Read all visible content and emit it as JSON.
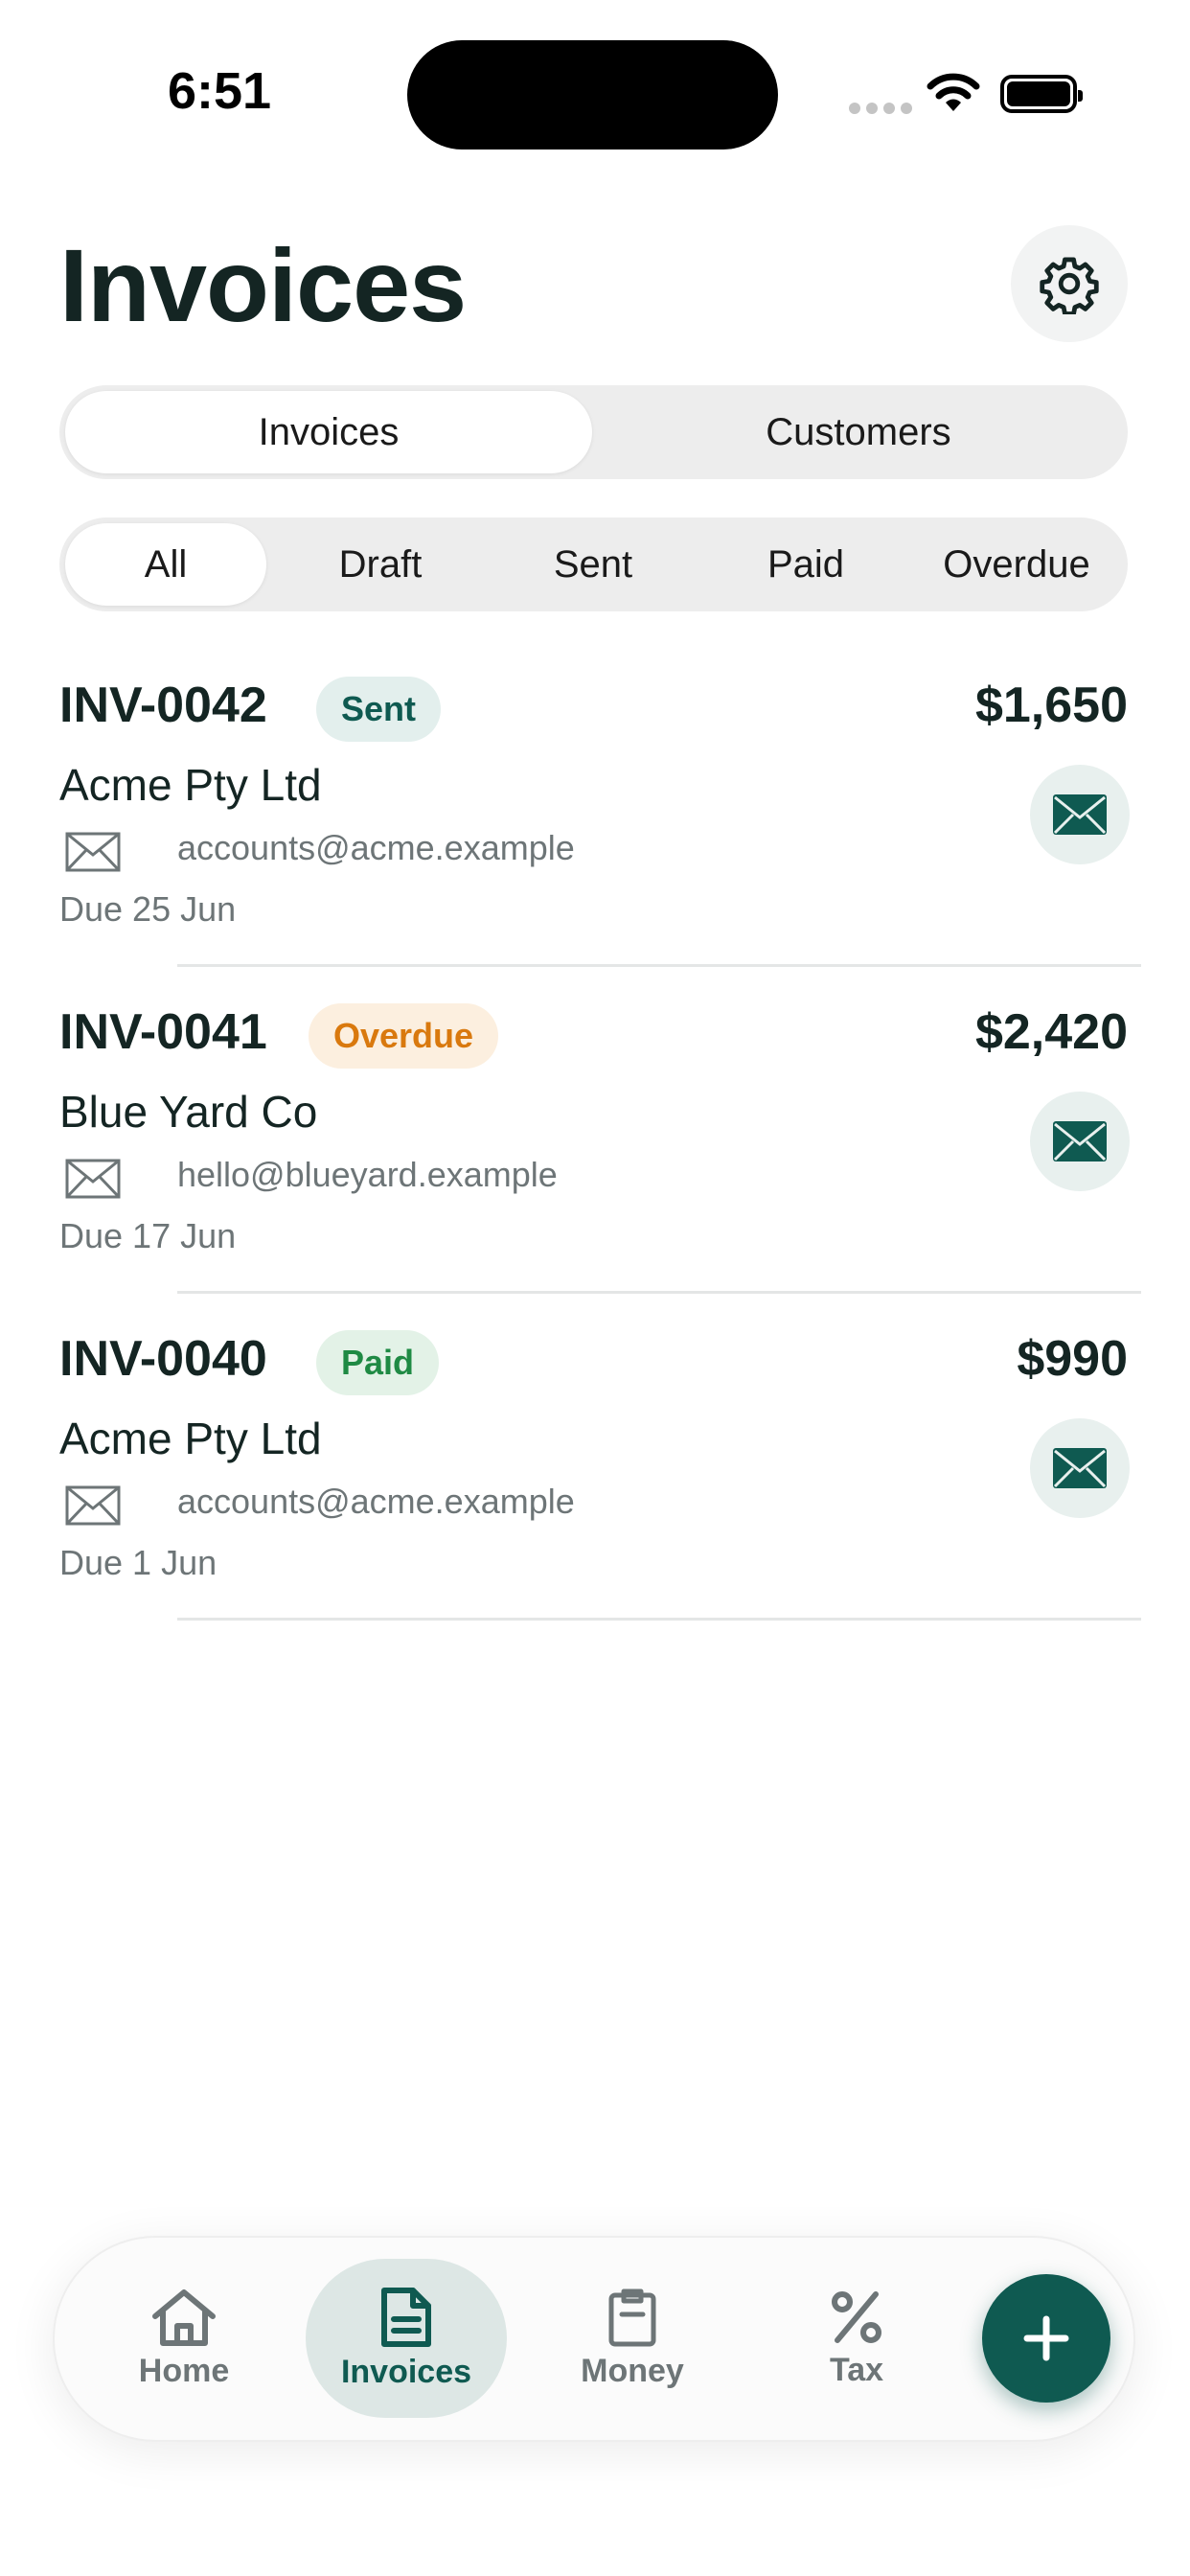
{
  "status_bar": {
    "time": "6:51"
  },
  "header": {
    "title": "Invoices"
  },
  "segments": [
    {
      "label": "Invoices",
      "active": true
    },
    {
      "label": "Customers",
      "active": false
    }
  ],
  "filters": [
    {
      "label": "All",
      "active": true
    },
    {
      "label": "Draft",
      "active": false
    },
    {
      "label": "Sent",
      "active": false
    },
    {
      "label": "Paid",
      "active": false
    },
    {
      "label": "Overdue",
      "active": false
    }
  ],
  "invoices": [
    {
      "number": "INV-0042",
      "status": "Sent",
      "amount": "$1,650",
      "customer": "Acme Pty Ltd",
      "email": "accounts@acme.example",
      "due": "Due 25 Jun"
    },
    {
      "number": "INV-0041",
      "status": "Overdue",
      "amount": "$2,420",
      "customer": "Blue Yard Co",
      "email": "hello@blueyard.example",
      "due": "Due 17 Jun"
    },
    {
      "number": "INV-0040",
      "status": "Paid",
      "amount": "$990",
      "customer": "Acme Pty Ltd",
      "email": "accounts@acme.example",
      "due": "Due 1 Jun"
    }
  ],
  "status_colors": {
    "Sent": {
      "bg": "#e3efed",
      "fg": "#0f5a51"
    },
    "Overdue": {
      "bg": "#fcefdf",
      "fg": "#d9790e"
    },
    "Paid": {
      "bg": "#e3f2e7",
      "fg": "#1f8a44"
    }
  },
  "tabs": [
    {
      "label": "Home",
      "icon": "home-icon",
      "active": false
    },
    {
      "label": "Invoices",
      "icon": "document-icon",
      "active": true
    },
    {
      "label": "Money",
      "icon": "clipboard-icon",
      "active": false
    },
    {
      "label": "Tax",
      "icon": "percent-icon",
      "active": false
    }
  ],
  "colors": {
    "accent": "#0f5a51",
    "text": "#142523",
    "muted": "#6d7577"
  }
}
